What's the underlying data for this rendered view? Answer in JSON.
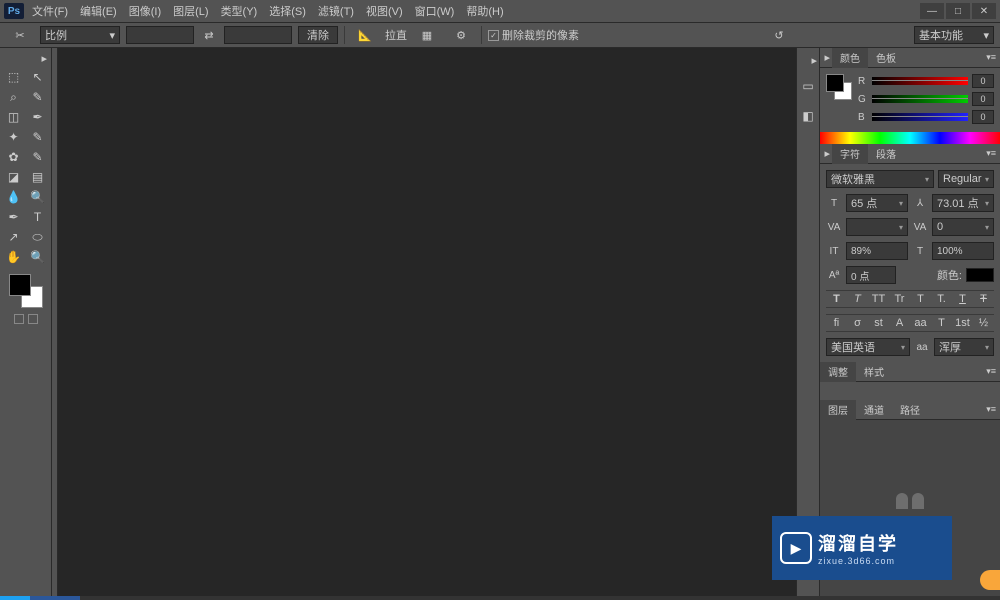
{
  "app": {
    "logo": "Ps"
  },
  "menu": [
    "文件(F)",
    "编辑(E)",
    "图像(I)",
    "图层(L)",
    "类型(Y)",
    "选择(S)",
    "滤镜(T)",
    "视图(V)",
    "窗口(W)",
    "帮助(H)"
  ],
  "win": {
    "min": "—",
    "max": "□",
    "close": "✕"
  },
  "options": {
    "ratio_label": "比例",
    "clear": "清除",
    "straighten": "拉直",
    "delete_cropped": "删除裁剪的像素",
    "workspace": "基本功能"
  },
  "colorPanel": {
    "tabs": [
      "颜色",
      "色板"
    ],
    "r": {
      "label": "R",
      "value": "0"
    },
    "g": {
      "label": "G",
      "value": "0"
    },
    "b": {
      "label": "B",
      "value": "0"
    }
  },
  "charPanel": {
    "tabs": [
      "字符",
      "段落"
    ],
    "font": "微软雅黑",
    "style": "Regular",
    "size": "65 点",
    "leading": "73.01 点",
    "tracking": "0",
    "vscale": "89%",
    "hscale": "100%",
    "baseline": "0 点",
    "colorLabel": "颜色:",
    "styleBtns": [
      "T",
      "T",
      "TT",
      "Tr",
      "T",
      "T.",
      "T",
      "Ŧ"
    ],
    "otBtns": [
      "fi",
      "σ",
      "st",
      "A",
      "aa",
      "T",
      "1st",
      "½"
    ],
    "lang": "美国英语",
    "aa": "浑厚",
    "aaIcon": "aa"
  },
  "adjPanel": {
    "tabs": [
      "调整",
      "样式"
    ]
  },
  "layerPanel": {
    "tabs": [
      "图层",
      "通道",
      "路径"
    ]
  },
  "watermark": {
    "brand": "溜溜自学",
    "url": "zixue.3d66.com"
  }
}
